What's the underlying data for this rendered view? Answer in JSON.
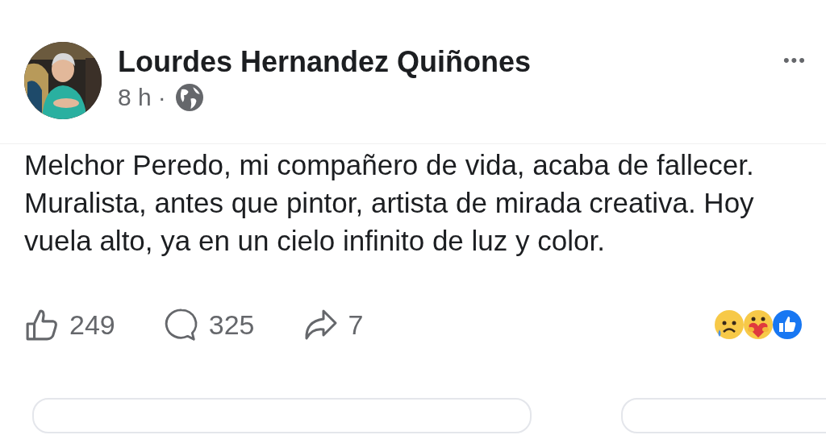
{
  "post": {
    "author": "Lourdes Hernandez Quiñones",
    "time": "8 h",
    "separator": "·",
    "more": "•••",
    "text": "Melchor Peredo, mi compañero de vida, acaba de fallecer. Muralista, antes que pintor, artista de mirada creativa. Hoy vuela alto, ya en un cielo infinito de luz y color."
  },
  "stats": [
    {
      "kind": "like",
      "count": "249"
    },
    {
      "kind": "comment",
      "count": "325"
    },
    {
      "kind": "share",
      "count": "7"
    }
  ]
}
